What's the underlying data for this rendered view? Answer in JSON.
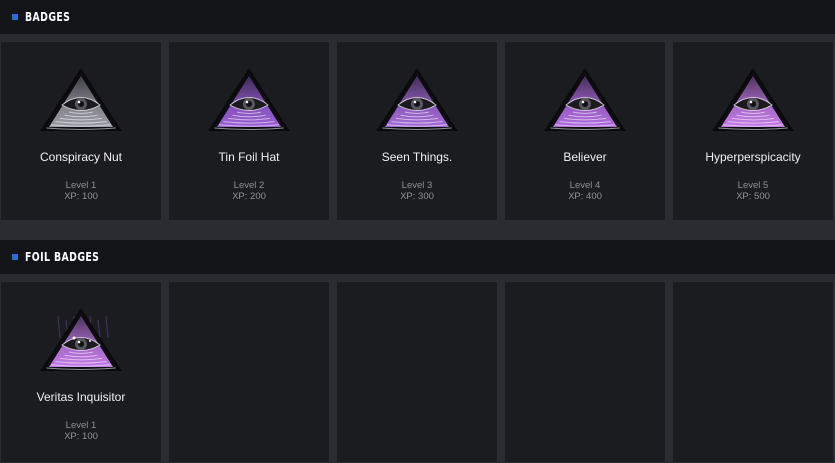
{
  "badges": {
    "title": "BADGES",
    "items": [
      {
        "name": "Conspiracy Nut",
        "level": "Level 1",
        "xp": "XP: 100",
        "tint": "#9a9aa6"
      },
      {
        "name": "Tin Foil Hat",
        "level": "Level 2",
        "xp": "XP: 200",
        "tint": "#9b5fd6"
      },
      {
        "name": "Seen Things.",
        "level": "Level 3",
        "xp": "XP: 300",
        "tint": "#a36ad8"
      },
      {
        "name": "Believer",
        "level": "Level 4",
        "xp": "XP: 400",
        "tint": "#b06be0"
      },
      {
        "name": "Hyperperspicacity",
        "level": "Level 5",
        "xp": "XP: 500",
        "tint": "#c47ae8"
      }
    ]
  },
  "foil_badges": {
    "title": "FOIL BADGES",
    "items": [
      {
        "name": "Veritas Inquisitor",
        "level": "Level 1",
        "xp": "XP: 100",
        "tint": "#c27ae8"
      }
    ]
  },
  "icon_name": "all-seeing-eye-pyramid-icon",
  "accent": "#2f6bd4"
}
